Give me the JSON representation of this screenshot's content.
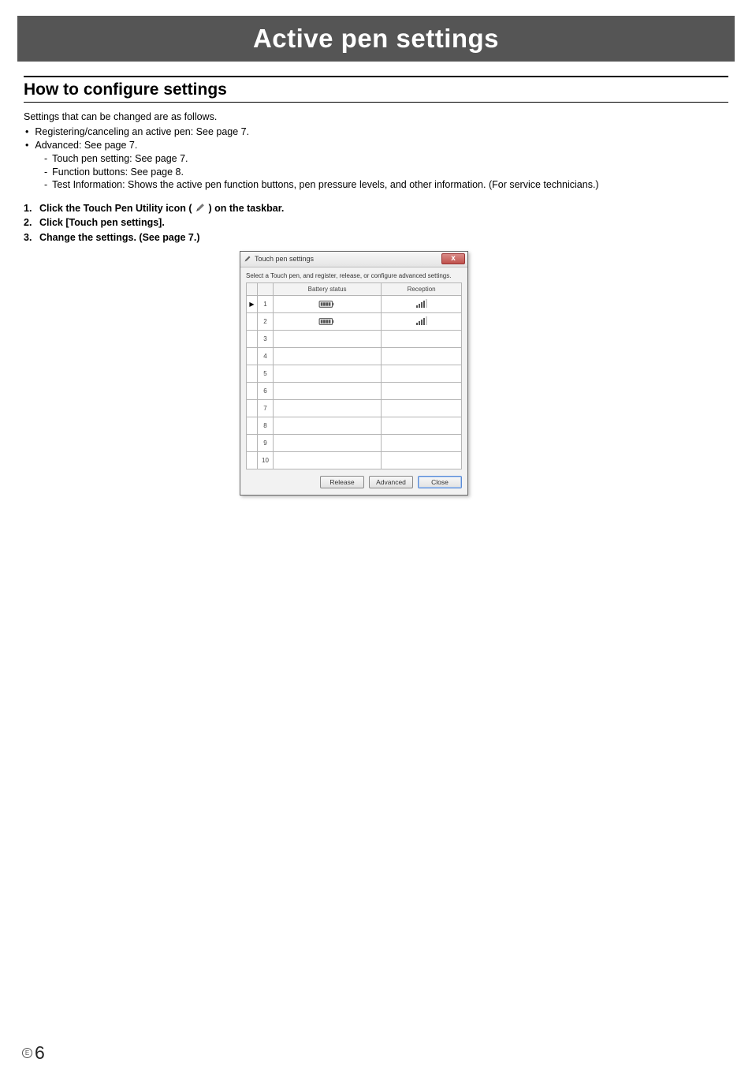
{
  "title": "Active pen settings",
  "section_heading": "How to configure settings",
  "intro": "Settings that can be changed are as follows.",
  "bullets": [
    "Registering/canceling an active pen: See page 7.",
    "Advanced: See page 7."
  ],
  "sub_bullets": [
    "Touch pen setting: See page 7.",
    "Function buttons: See page 8.",
    "Test Information: Shows the active pen function buttons, pen pressure levels, and other information. (For service technicians.)"
  ],
  "steps": {
    "s1_a": "Click the Touch Pen Utility icon (",
    "s1_b": ") on the taskbar.",
    "s2": "Click [Touch pen settings].",
    "s3": "Change the settings. (See page 7.)"
  },
  "dialog": {
    "title": "Touch pen settings",
    "desc": "Select a Touch pen, and register, release, or configure advanced settings.",
    "headers": {
      "battery": "Battery status",
      "reception": "Reception"
    },
    "rows": [
      "1",
      "2",
      "3",
      "4",
      "5",
      "6",
      "7",
      "8",
      "9",
      "10"
    ],
    "filled_rows": 2,
    "buttons": {
      "release": "Release",
      "advanced": "Advanced",
      "close": "Close"
    }
  },
  "footer": {
    "e": "E",
    "page": "6"
  }
}
